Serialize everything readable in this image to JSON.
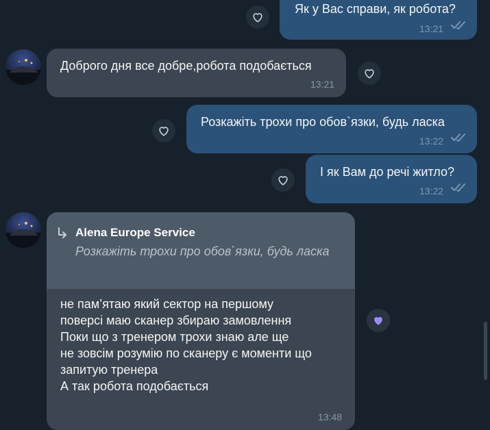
{
  "messages": [
    {
      "direction": "out",
      "text": "Як у Вас справи, як робота?",
      "time": "13:21",
      "liked": false
    },
    {
      "direction": "in",
      "text": "Доброго дня все добре,робота подобається",
      "time": "13:21",
      "liked": false
    },
    {
      "direction": "out",
      "text": "Розкажіть трохи про обов`язки, будь ласка",
      "time": "13:22",
      "liked": false
    },
    {
      "direction": "out",
      "text": "І як Вам до речі житло?",
      "time": "13:22",
      "liked": false
    },
    {
      "direction": "in",
      "reply": {
        "name": "Alena Europe Service",
        "quote": "Розкажіть трохи про обов`язки, будь ласка"
      },
      "lines": [
        "не пам’ятаю який сектор на першому",
        "поверсі маю сканер збираю замовлення",
        "Поки що з тренером трохи знаю але ще",
        "не зовсім розумію по сканеру є моменти що",
        "запитую тренера",
        "А так робота подобається"
      ],
      "time": "13:48",
      "liked": true
    }
  ],
  "colors": {
    "background": "#17212b",
    "outgoing_bubble": "#2b5278",
    "incoming_bubble": "#3b4652",
    "reply_header": "#4d5a68",
    "check_color": "#7c98b3",
    "heart_filled": "#9b8cf5"
  },
  "icons": {
    "reaction": "heart-outline-icon",
    "reaction_active": "heart-filled-icon",
    "read_status": "double-check-icon",
    "reply": "reply-arrow-icon"
  }
}
